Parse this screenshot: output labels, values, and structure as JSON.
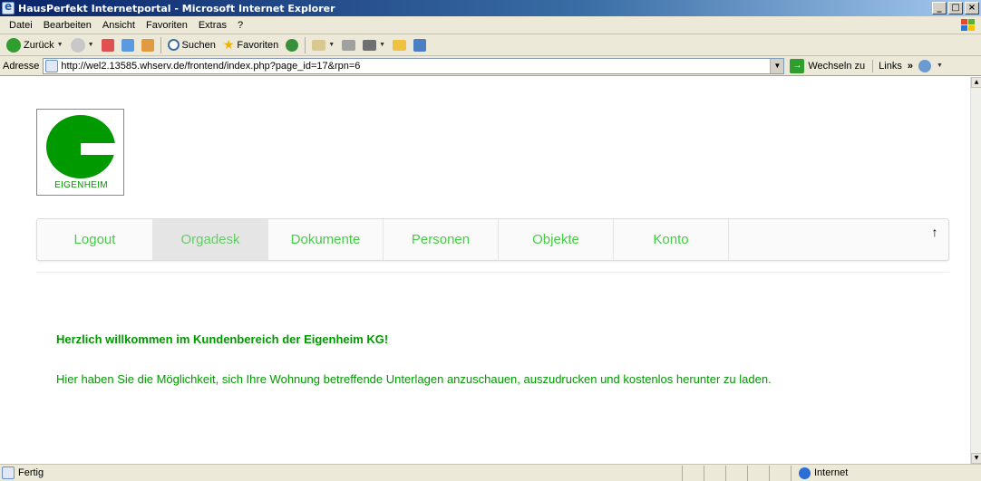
{
  "window": {
    "title": "HausPerfekt Internetportal - Microsoft Internet Explorer",
    "minimize": "_",
    "restore": "□",
    "close": "×"
  },
  "menu": {
    "items": [
      "Datei",
      "Bearbeiten",
      "Ansicht",
      "Favoriten",
      "Extras",
      "?"
    ]
  },
  "toolbar": {
    "back_label": "Zurück",
    "search_label": "Suchen",
    "favorites_label": "Favoriten"
  },
  "address": {
    "label": "Adresse",
    "url": "http://wel2.13585.whserv.de/frontend/index.php?page_id=17&rpn=6",
    "go_label": "Wechseln zu",
    "links_label": "Links",
    "links_chevron": "»"
  },
  "logo": {
    "text": "EIGENHEIM",
    "color": "#009900"
  },
  "nav": {
    "items": [
      {
        "label": "Logout"
      },
      {
        "label": "Orgadesk",
        "active": true
      },
      {
        "label": "Dokumente"
      },
      {
        "label": "Personen"
      },
      {
        "label": "Objekte"
      },
      {
        "label": "Konto"
      }
    ],
    "up_arrow": "↑"
  },
  "main": {
    "welcome": "Herzlich willkommen im Kundenbereich der Eigenheim KG!",
    "info": "Hier haben Sie die Möglichkeit, sich Ihre Wohnung betreffende Unterlagen anzuschauen, auszudrucken und kostenlos herunter zu laden."
  },
  "status": {
    "text": "Fertig",
    "zone": "Internet"
  },
  "colors": {
    "brand_green": "#009900",
    "nav_green": "#44cc44"
  }
}
